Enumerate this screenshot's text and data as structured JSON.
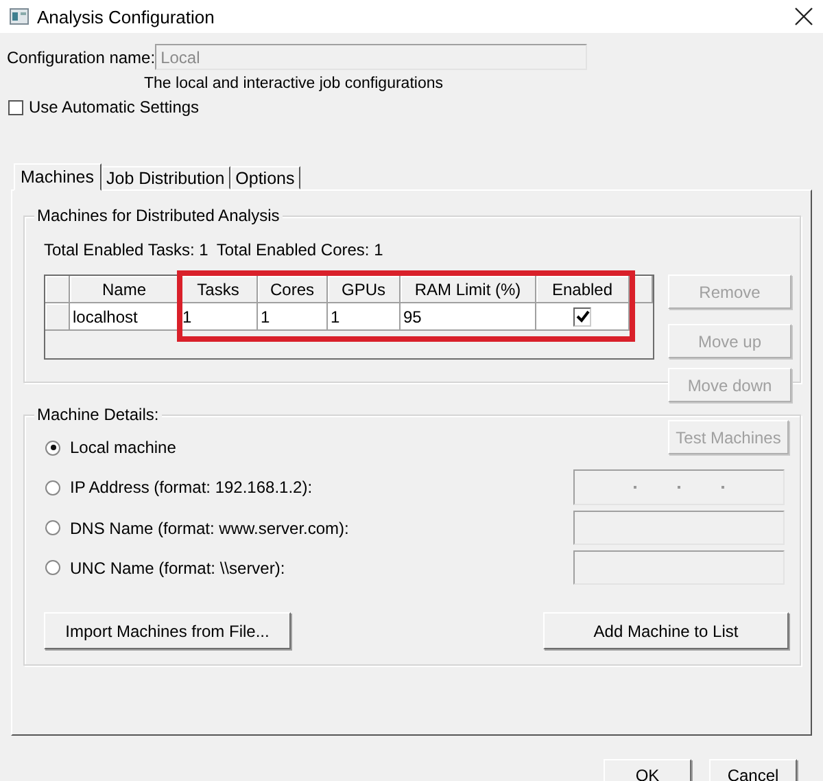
{
  "window": {
    "title": "Analysis Configuration"
  },
  "configuration_name": {
    "label": "Configuration name:",
    "value": "Local",
    "disabled": true
  },
  "description": "The local and interactive job configurations",
  "use_automatic_settings": {
    "label": "Use Automatic Settings",
    "checked": false
  },
  "tabs": [
    {
      "label": "Machines",
      "selected": true
    },
    {
      "label": "Job Distribution",
      "selected": false
    },
    {
      "label": "Options",
      "selected": false
    }
  ],
  "machines_group": {
    "title": "Machines for Distributed Analysis",
    "summary": [
      "Total Enabled Tasks: 1",
      "Total Enabled Cores: 1"
    ],
    "table": {
      "columns": [
        "Name",
        "Tasks",
        "Cores",
        "GPUs",
        "RAM Limit (%)",
        "Enabled"
      ],
      "rows": [
        {
          "cells": [
            "localhost",
            "1",
            "1",
            "1",
            "95"
          ],
          "enabled": true
        }
      ]
    },
    "buttons": [
      {
        "label": "Remove",
        "disabled": true
      },
      {
        "label": "Move up",
        "disabled": true
      },
      {
        "label": "Move down",
        "disabled": true
      }
    ]
  },
  "machine_details": {
    "title": "Machine Details:",
    "test_button": {
      "label": "Test Machines",
      "disabled": true
    },
    "options": [
      {
        "label": "Local machine",
        "selected": true
      },
      {
        "label": "IP Address (format: 192.168.1.2):",
        "selected": false,
        "kind": "ip"
      },
      {
        "label": "DNS Name (format: www.server.com):",
        "selected": false,
        "kind": "text"
      },
      {
        "label": "UNC Name (format: \\\\server):",
        "selected": false,
        "kind": "text"
      }
    ],
    "buttons": [
      {
        "label": "Import Machines from File...",
        "disabled": false
      },
      {
        "label": "Add Machine to List",
        "disabled": false
      }
    ]
  },
  "dialog_buttons": [
    {
      "label": "OK",
      "disabled": false
    },
    {
      "label": "Cancel",
      "disabled": false
    }
  ]
}
